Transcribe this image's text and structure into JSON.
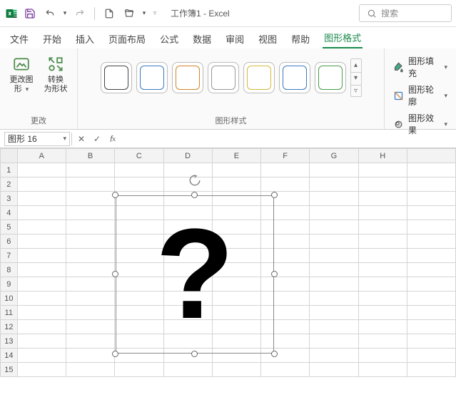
{
  "titlebar": {
    "title": "工作簿1 - Excel",
    "search_placeholder": "搜索"
  },
  "tabs": [
    "文件",
    "开始",
    "插入",
    "页面布局",
    "公式",
    "数据",
    "审阅",
    "视图",
    "帮助",
    "图形格式"
  ],
  "active_tab": "图形格式",
  "ribbon": {
    "change": {
      "btn1_l1": "更改图",
      "btn1_l2": "形",
      "btn2_l1": "转换",
      "btn2_l2": "为形状",
      "group_label": "更改"
    },
    "styles_label": "图形样式",
    "fill": {
      "fill": "图形填充",
      "outline": "图形轮廓",
      "effects": "图形效果"
    }
  },
  "nameBox": "图形 16",
  "columns": [
    "A",
    "B",
    "C",
    "D",
    "E",
    "F",
    "G",
    "H"
  ],
  "rows": [
    "1",
    "2",
    "3",
    "4",
    "5",
    "6",
    "7",
    "8",
    "9",
    "10",
    "11",
    "12",
    "13",
    "14",
    "15"
  ],
  "shape_glyph": "?"
}
